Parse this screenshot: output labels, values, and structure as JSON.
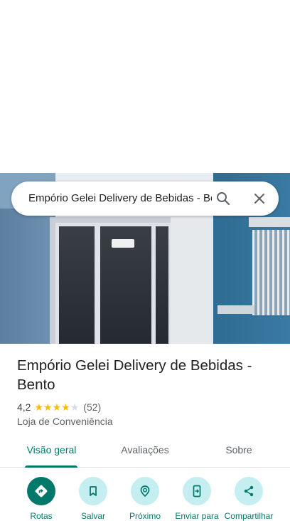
{
  "search": {
    "query": "Empório Gelei Delivery de Bebidas - Bento",
    "search_icon": "search-icon",
    "close_icon": "close-icon"
  },
  "place": {
    "name": "Empório Gelei Delivery de Bebidas - Bento",
    "rating": "4,2",
    "stars": 4,
    "stars_max": 5,
    "review_count": "(52)",
    "category": "Loja de Conveniência"
  },
  "tabs": [
    {
      "label": "Visão geral",
      "active": true
    },
    {
      "label": "Avaliações",
      "active": false
    },
    {
      "label": "Sobre",
      "active": false
    }
  ],
  "actions": [
    {
      "label": "Rotas",
      "icon": "directions-icon"
    },
    {
      "label": "Salvar",
      "icon": "bookmark-icon"
    },
    {
      "label": "Próximo",
      "icon": "nearby-icon"
    },
    {
      "label": "Enviar para",
      "icon": "send-to-phone-icon"
    },
    {
      "label": "Compartilhar",
      "icon": "share-icon"
    }
  ],
  "colors": {
    "accent": "#00796b",
    "action_bg": "#c4eef0",
    "star": "#fbbc04"
  }
}
